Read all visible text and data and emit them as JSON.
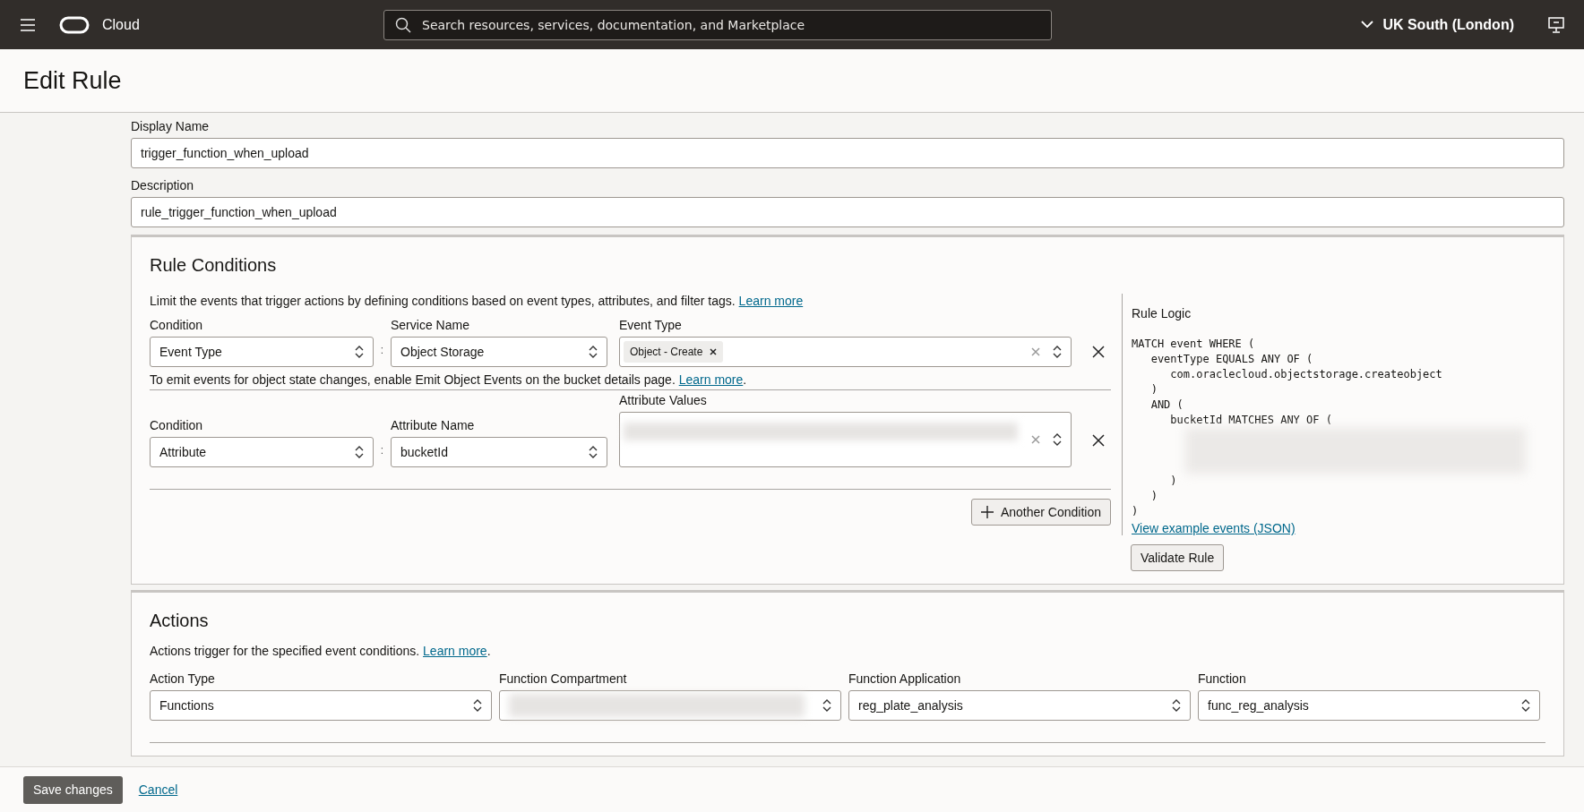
{
  "top_bar": {
    "product": "Cloud",
    "search": {
      "placeholder": "Search resources, services, documentation, and Marketplace"
    },
    "region": "UK South (London)"
  },
  "page": {
    "title": "Edit Rule"
  },
  "fields": [
    {
      "label": "Display Name",
      "value": "trigger_function_when_upload"
    },
    {
      "label": "Description",
      "value": "rule_trigger_function_when_upload"
    }
  ],
  "rule_conditions": {
    "title": "Rule Conditions",
    "intro": "Limit the events that trigger actions by defining conditions based on event types, attributes, and filter tags.",
    "intro_link": "Learn more",
    "conditions": [
      {
        "condition_label": "Condition",
        "condition": "Event Type",
        "separator": ":",
        "name_label": "Service Name",
        "name": "Object Storage",
        "values_label": "Event Type",
        "tags": [
          "Object - Create"
        ],
        "redacted": false,
        "note": "To emit events for object state changes, enable Emit Object Events on the bucket details page.",
        "note_link": "Learn more",
        "note_suffix": "."
      },
      {
        "condition_label": "Condition",
        "condition": "Attribute",
        "separator": ":",
        "name_label": "Attribute Name",
        "name": "bucketId",
        "values_label": "Attribute Values",
        "redacted": true
      }
    ],
    "add_button": "Another Condition",
    "logic": {
      "title": "Rule Logic",
      "lines": [
        {
          "kind": "code",
          "text": "MATCH event WHERE ("
        },
        {
          "kind": "code",
          "text": "   eventType EQUALS ANY OF ("
        },
        {
          "kind": "code",
          "text": "      com.oraclecloud.objectstorage.createobject"
        },
        {
          "kind": "code",
          "text": "   )"
        },
        {
          "kind": "code",
          "text": "   AND ("
        },
        {
          "kind": "code",
          "text": "      bucketId MATCHES ANY OF ("
        },
        {
          "kind": "redacted"
        },
        {
          "kind": "code",
          "text": "      )"
        },
        {
          "kind": "code",
          "text": "   )"
        },
        {
          "kind": "code",
          "text": ")"
        }
      ],
      "link": "View example events (JSON)",
      "validate_button": "Validate Rule"
    }
  },
  "actions": {
    "title": "Actions",
    "intro": "Actions trigger for the specified event conditions.",
    "intro_link": "Learn more",
    "intro_suffix": ".",
    "fields": [
      {
        "label": "Action Type",
        "value": "Functions",
        "redacted": false
      },
      {
        "label": "Function Compartment",
        "redacted": true
      },
      {
        "label": "Function Application",
        "value": "reg_plate_analysis",
        "redacted": false
      },
      {
        "label": "Function",
        "value": "func_reg_analysis",
        "redacted": false
      }
    ]
  },
  "footer": {
    "save_button": "Save changes",
    "cancel_link": "Cancel"
  }
}
